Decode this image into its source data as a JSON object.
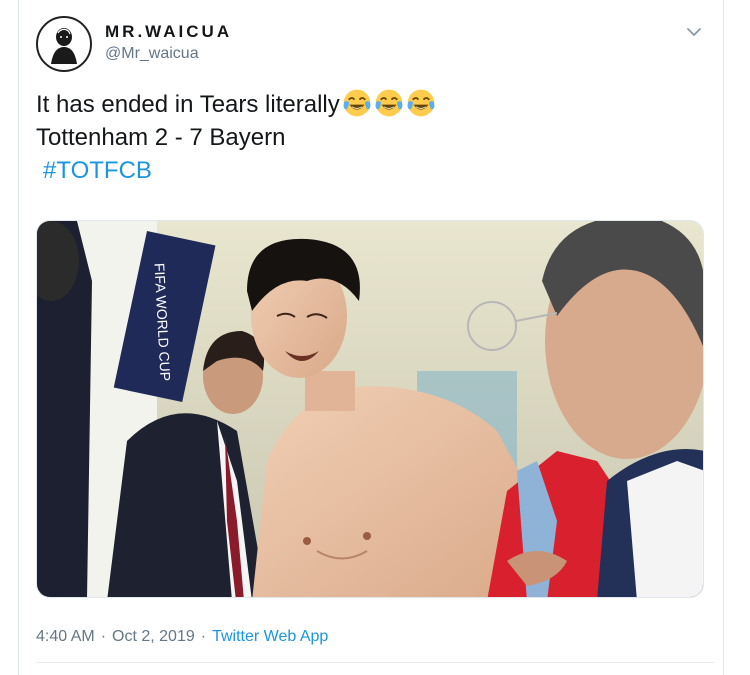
{
  "user": {
    "display_name": "MR.WAICUA",
    "handle": "@Mr_waicua"
  },
  "tweet": {
    "line1": "It has ended in Tears literally",
    "emojis": [
      "face-with-tears-of-joy",
      "face-with-tears-of-joy",
      "face-with-tears-of-joy"
    ],
    "line2": "Tottenham 2 - 7 Bayern",
    "hashtag": "#TOTFCB"
  },
  "photo": {
    "banner_text": "FIFA WORLD CUP"
  },
  "meta": {
    "time": "4:40 AM",
    "separator": "·",
    "date": "Oct 2, 2019",
    "source": "Twitter Web App"
  },
  "colors": {
    "link": "#1b95e0",
    "secondary_text": "#657786",
    "primary_text": "#14171a",
    "border": "#e1e8ed"
  }
}
